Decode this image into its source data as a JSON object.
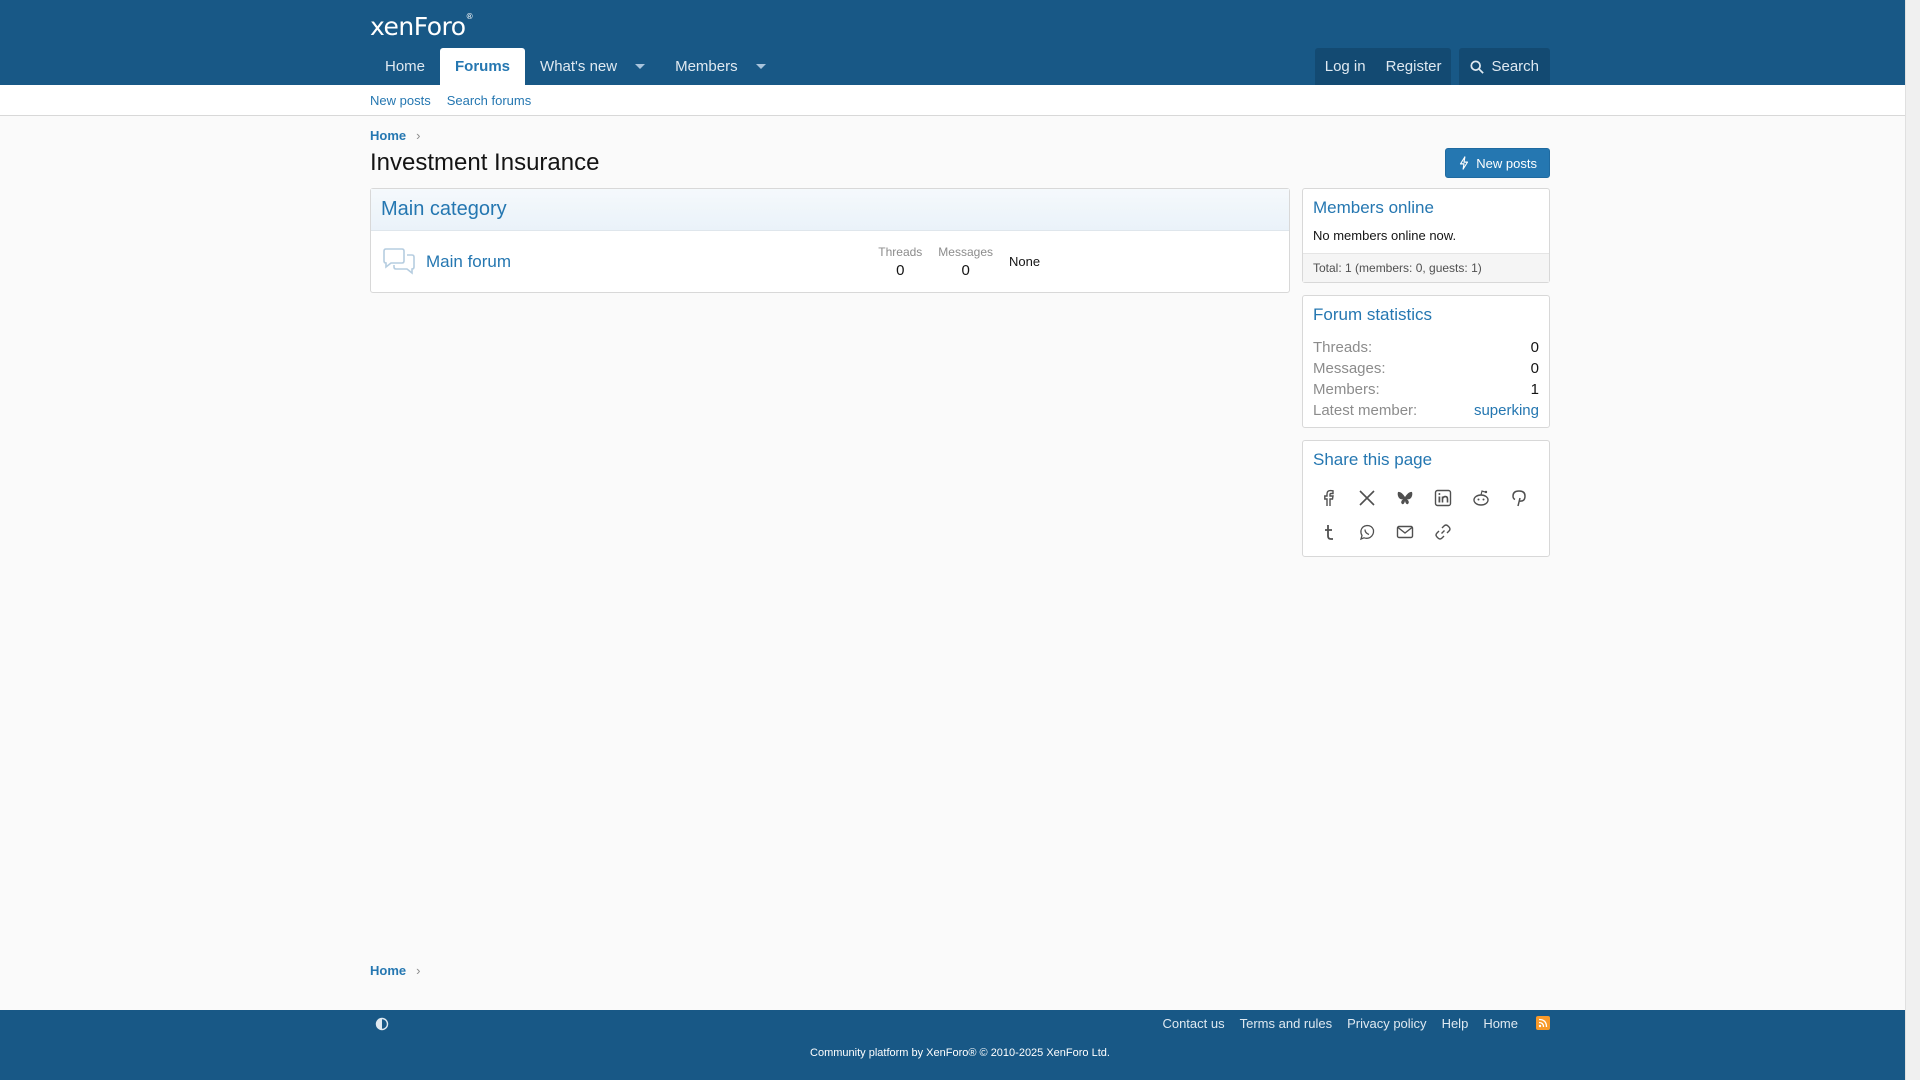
{
  "header": {
    "logo": "xenForo",
    "nav": [
      {
        "label": "Home"
      },
      {
        "label": "Forums"
      },
      {
        "label": "What's new"
      },
      {
        "label": "Members"
      }
    ],
    "login": "Log in",
    "register": "Register",
    "search": "Search"
  },
  "subnav": [
    "New posts",
    "Search forums"
  ],
  "breadcrumb": {
    "home": "Home"
  },
  "page": {
    "title": "Investment Insurance",
    "new_posts_button": "New posts"
  },
  "category": {
    "title": "Main category",
    "forums": [
      {
        "title": "Main forum",
        "threads_label": "Threads",
        "threads": "0",
        "messages_label": "Messages",
        "messages": "0",
        "last_post": "None"
      }
    ]
  },
  "sidebar": {
    "members_online": {
      "title": "Members online",
      "body": "No members online now.",
      "footer": "Total: 1 (members: 0, guests: 1)"
    },
    "forum_statistics": {
      "title": "Forum statistics",
      "rows": [
        {
          "k": "Threads:",
          "v": "0"
        },
        {
          "k": "Messages:",
          "v": "0"
        },
        {
          "k": "Members:",
          "v": "1"
        },
        {
          "k": "Latest member:",
          "v": "superking"
        }
      ]
    },
    "share": {
      "title": "Share this page",
      "icons": [
        "facebook-icon",
        "x-icon",
        "bluesky-icon",
        "linkedin-icon",
        "reddit-icon",
        "pinterest-icon",
        "tumblr-icon",
        "whatsapp-icon",
        "email-icon",
        "link-icon"
      ]
    }
  },
  "footer": {
    "links": [
      "Contact us",
      "Terms and rules",
      "Privacy policy",
      "Help",
      "Home"
    ],
    "copyright": "Community platform by XenForo® © 2010-2025 XenForo Ltd."
  },
  "colors": {
    "brand": "#185886",
    "link": "#2577b1"
  }
}
